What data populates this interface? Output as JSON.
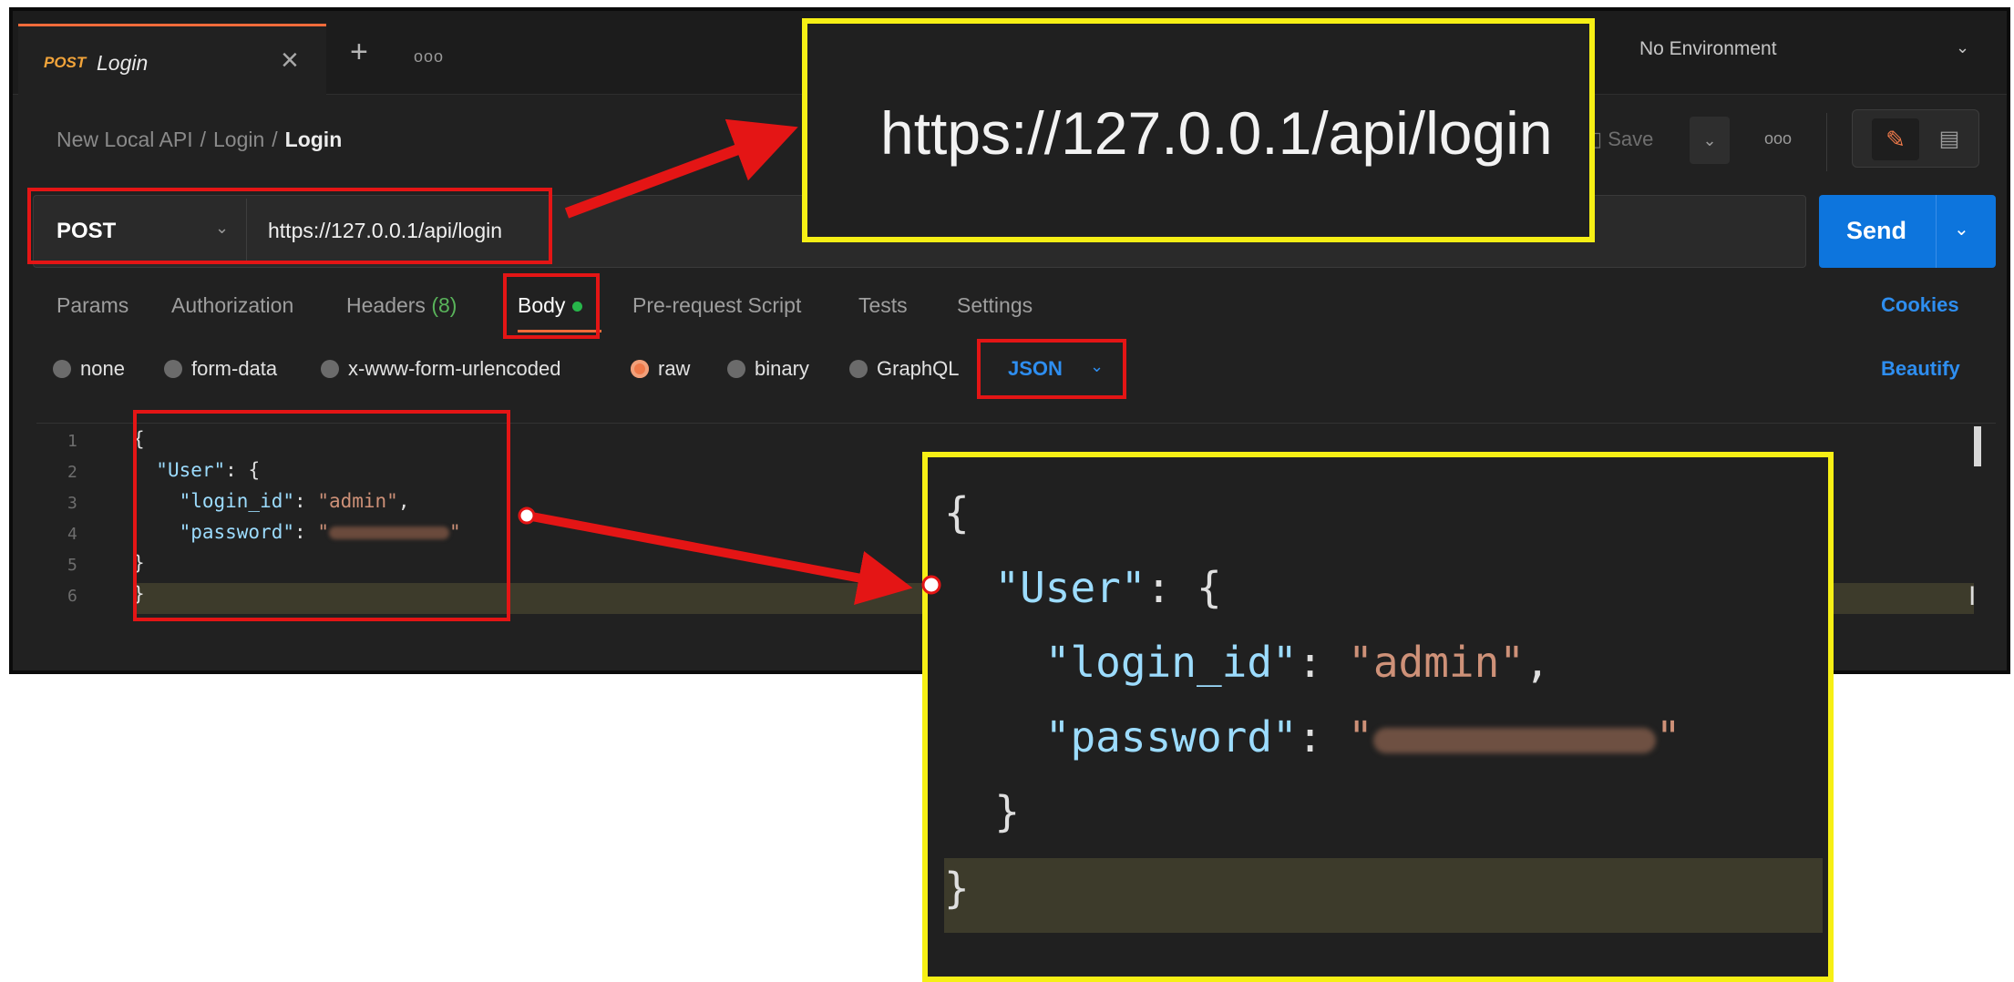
{
  "tab": {
    "method": "POST",
    "name": "Login"
  },
  "environment": {
    "label": "No Environment"
  },
  "breadcrumb": {
    "part1": "New Local API",
    "part2": "Login",
    "current": "Login",
    "separator": "/"
  },
  "toolbar": {
    "save_label": "Save"
  },
  "request": {
    "method": "POST",
    "url": "https://127.0.0.1/api/login",
    "send_label": "Send"
  },
  "request_tabs": {
    "params": "Params",
    "authorization": "Authorization",
    "headers": "Headers",
    "headers_count": "(8)",
    "body": "Body",
    "prerequest": "Pre-request Script",
    "tests": "Tests",
    "settings": "Settings",
    "cookies": "Cookies"
  },
  "body_options": {
    "none": "none",
    "form_data": "form-data",
    "urlencoded": "x-www-form-urlencoded",
    "raw": "raw",
    "binary": "binary",
    "graphql": "GraphQL",
    "format": "JSON",
    "beautify": "Beautify",
    "selected": "raw"
  },
  "editor": {
    "line_numbers": [
      "1",
      "2",
      "3",
      "4",
      "5",
      "6"
    ],
    "brace_open": "{",
    "user_key": "\"User\"",
    "login_key": "\"login_id\"",
    "login_value": "\"admin\"",
    "password_key": "\"password\"",
    "quote": "\"",
    "inner_close": "}",
    "brace_close": "}"
  },
  "zoom": {
    "url": "https://127.0.0.1/api/login"
  },
  "colors": {
    "accent": "#f26b3a",
    "send": "#0d75dd",
    "link": "#2e8ef0",
    "annotation_red": "#e41515",
    "annotation_yellow": "#f6ef15"
  },
  "icons": [
    "close-icon",
    "plus-icon",
    "more-icon",
    "chevron-down-icon",
    "save-icon",
    "pencil-icon",
    "comment-icon"
  ]
}
